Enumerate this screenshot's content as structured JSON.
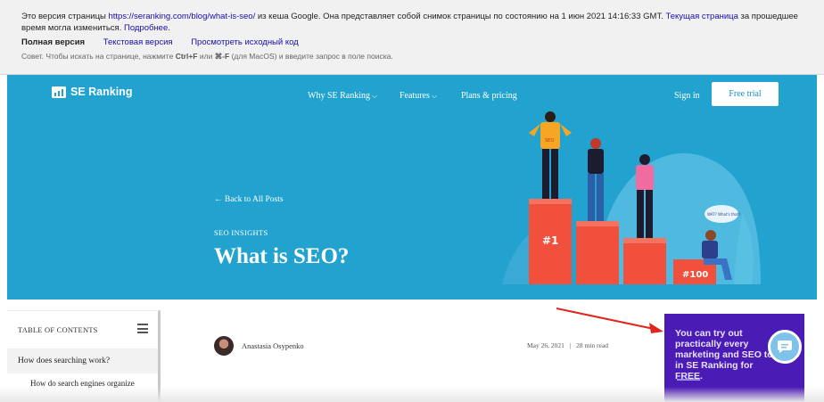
{
  "cache_bar": {
    "text_1": "Это версия страницы ",
    "url": "https://seranking.com/blog/what-is-seo/",
    "text_2": " из кеша Google. Она представляет собой снимок страницы по состоянию на 1 июн 2021 14:16:33 GMT. ",
    "current_page_link": "Текущая страница",
    "text_3": " за прошедшее время могла измениться. ",
    "more_link": "Подробнее.",
    "full_version": "Полная версия",
    "text_version": "Текстовая версия",
    "view_source": "Просмотреть исходный код",
    "tip_prefix": "Совет. Чтобы искать на странице, нажмите ",
    "tip_key1": "Ctrl+F",
    "tip_mid": " или ",
    "tip_key2": "⌘-F",
    "tip_suffix": " (для MacOS) и введите запрос в поле поиска."
  },
  "header": {
    "logo": "SE Ranking",
    "nav": [
      {
        "label": "Why SE Ranking",
        "dropdown": true
      },
      {
        "label": "Features",
        "dropdown": true
      },
      {
        "label": "Plans & pricing",
        "dropdown": false
      }
    ],
    "sign_in": "Sign in",
    "free_trial": "Free trial"
  },
  "hero": {
    "back_link": "← Back to All Posts",
    "category": "SEO INSIGHTS",
    "title": "What is SEO?",
    "podium_1": "#1",
    "podium_100": "#100",
    "shirt_label": "SEO",
    "speech_bubble": "WAT? What's that?"
  },
  "toc": {
    "title": "TABLE OF CONTENTS",
    "items": [
      "How does searching work?",
      "How do search engines organize"
    ]
  },
  "post": {
    "author": "Anastasia Osypenko",
    "date": "May 26, 2021",
    "separator": "|",
    "read_time": "28 min read"
  },
  "promo": {
    "text": "You can try out practically every marketing and SEO tool in SE Ranking for FREE."
  },
  "colors": {
    "hero_bg": "#22a3cf",
    "promo_bg": "#4a1bb5",
    "link": "#1a0dab",
    "podium": "#f0503c"
  }
}
